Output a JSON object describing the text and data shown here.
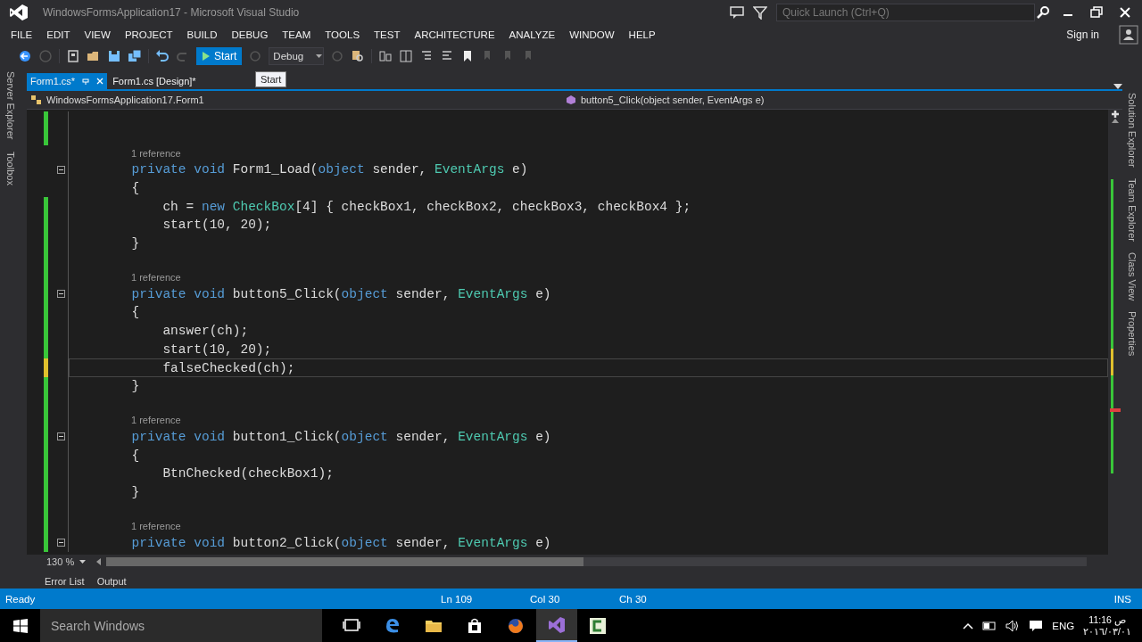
{
  "window": {
    "title": "WindowsFormsApplication17 - Microsoft Visual Studio",
    "quick_launch": {
      "placeholder": "Quick Launch (Ctrl+Q)"
    },
    "sign_in": "Sign in"
  },
  "menu": [
    "FILE",
    "EDIT",
    "VIEW",
    "PROJECT",
    "BUILD",
    "DEBUG",
    "TEAM",
    "TOOLS",
    "TEST",
    "ARCHITECTURE",
    "ANALYZE",
    "WINDOW",
    "HELP"
  ],
  "toolbar": {
    "start": {
      "label": "Start",
      "highlighted": true
    },
    "configuration": "Debug",
    "tooltip": "Start"
  },
  "left_panels": [
    "Server Explorer",
    "Toolbox"
  ],
  "tabs": [
    {
      "label": "Form1.cs*",
      "selected": true
    },
    {
      "label": "Form1.cs [Design]*",
      "selected": false
    }
  ],
  "nav": {
    "class": "WindowsFormsApplication17.Form1",
    "member": "button5_Click(object sender, EventArgs e)"
  },
  "editor": {
    "zoom": "130 %",
    "lines": [
      {
        "kind": "blank",
        "color": "#39c639"
      },
      {
        "kind": "blank",
        "color": "#39c639"
      },
      {
        "kind": "ref",
        "text": "1 reference"
      },
      {
        "kind": "code",
        "fold": true,
        "current": false,
        "tokens": [
          {
            "kind": "keyword",
            "text": "        private"
          },
          {
            "kind": "keyword",
            "text": " void"
          },
          {
            "kind": "plain",
            "text": " Form1_Load("
          },
          {
            "kind": "keyword",
            "text": "object"
          },
          {
            "kind": "plain",
            "text": " sender, "
          },
          {
            "kind": "type",
            "text": "EventArgs"
          },
          {
            "kind": "plain",
            "text": " e)"
          }
        ]
      },
      {
        "kind": "code",
        "fold": false,
        "current": false,
        "tokens": [
          {
            "kind": "plain",
            "text": "        {"
          }
        ]
      },
      {
        "kind": "code",
        "color": "#39c639",
        "fold": false,
        "current": false,
        "tokens": [
          {
            "kind": "plain",
            "text": "            ch = "
          },
          {
            "kind": "keyword",
            "text": "new"
          },
          {
            "kind": "type",
            "text": " CheckBox"
          },
          {
            "kind": "plain",
            "text": "[4] { checkBox1, checkBox2, checkBox3, checkBox4 };"
          }
        ]
      },
      {
        "kind": "code",
        "color": "#39c639",
        "fold": false,
        "current": false,
        "tokens": [
          {
            "kind": "plain",
            "text": "            start(10, 20);"
          }
        ]
      },
      {
        "kind": "code",
        "color": "#39c639",
        "fold": false,
        "current": false,
        "tokens": [
          {
            "kind": "plain",
            "text": "        }"
          }
        ]
      },
      {
        "kind": "blank",
        "color": "#39c639"
      },
      {
        "kind": "ref",
        "text": "1 reference",
        "color": "#39c639"
      },
      {
        "kind": "code",
        "color": "#39c639",
        "fold": true,
        "current": false,
        "tokens": [
          {
            "kind": "keyword",
            "text": "        private"
          },
          {
            "kind": "keyword",
            "text": " void"
          },
          {
            "kind": "plain",
            "text": " button5_Click("
          },
          {
            "kind": "keyword",
            "text": "object"
          },
          {
            "kind": "plain",
            "text": " sender, "
          },
          {
            "kind": "type",
            "text": "EventArgs"
          },
          {
            "kind": "plain",
            "text": " e)"
          }
        ]
      },
      {
        "kind": "code",
        "color": "#39c639",
        "fold": false,
        "current": false,
        "tokens": [
          {
            "kind": "plain",
            "text": "        {"
          }
        ]
      },
      {
        "kind": "code",
        "color": "#39c639",
        "fold": false,
        "current": false,
        "tokens": [
          {
            "kind": "plain",
            "text": "            answer(ch);"
          }
        ]
      },
      {
        "kind": "code",
        "color": "#39c639",
        "fold": false,
        "current": false,
        "tokens": [
          {
            "kind": "plain",
            "text": "            start(10, 20);"
          }
        ]
      },
      {
        "kind": "code",
        "color": "#e0c02d",
        "fold": false,
        "current": true,
        "tokens": [
          {
            "kind": "plain",
            "text": "            falseChecked(ch);"
          }
        ]
      },
      {
        "kind": "code",
        "color": "#39c639",
        "fold": false,
        "current": false,
        "tokens": [
          {
            "kind": "plain",
            "text": "        }"
          }
        ]
      },
      {
        "kind": "blank",
        "color": "#39c639"
      },
      {
        "kind": "ref",
        "text": "1 reference",
        "color": "#39c639"
      },
      {
        "kind": "code",
        "color": "#39c639",
        "fold": true,
        "current": false,
        "tokens": [
          {
            "kind": "keyword",
            "text": "        private"
          },
          {
            "kind": "keyword",
            "text": " void"
          },
          {
            "kind": "plain",
            "text": " button1_Click("
          },
          {
            "kind": "keyword",
            "text": "object"
          },
          {
            "kind": "plain",
            "text": " sender, "
          },
          {
            "kind": "type",
            "text": "EventArgs"
          },
          {
            "kind": "plain",
            "text": " e)"
          }
        ]
      },
      {
        "kind": "code",
        "color": "#39c639",
        "fold": false,
        "current": false,
        "tokens": [
          {
            "kind": "plain",
            "text": "        {"
          }
        ]
      },
      {
        "kind": "code",
        "color": "#39c639",
        "fold": false,
        "current": false,
        "tokens": [
          {
            "kind": "plain",
            "text": "            BtnChecked(checkBox1);"
          }
        ]
      },
      {
        "kind": "code",
        "color": "#39c639",
        "fold": false,
        "current": false,
        "tokens": [
          {
            "kind": "plain",
            "text": "        }"
          }
        ]
      },
      {
        "kind": "blank",
        "color": "#39c639"
      },
      {
        "kind": "ref",
        "text": "1 reference",
        "color": "#39c639"
      },
      {
        "kind": "code",
        "color": "#39c639",
        "fold": true,
        "current": false,
        "tokens": [
          {
            "kind": "keyword",
            "text": "        private"
          },
          {
            "kind": "keyword",
            "text": " void"
          },
          {
            "kind": "plain",
            "text": " button2_Click("
          },
          {
            "kind": "keyword",
            "text": "object"
          },
          {
            "kind": "plain",
            "text": " sender, "
          },
          {
            "kind": "type",
            "text": "EventArgs"
          },
          {
            "kind": "plain",
            "text": " e)"
          }
        ]
      }
    ]
  },
  "right_panels": [
    "Solution Explorer",
    "Team Explorer",
    "Class View",
    "Properties"
  ],
  "bottom_tabs": [
    "Error List",
    "Output"
  ],
  "status_bar": {
    "message": "Ready",
    "line": "Ln 109",
    "col": "Col 30",
    "ch": "Ch 30",
    "mode": "INS"
  },
  "taskbar": {
    "search": {
      "placeholder": "Search Windows"
    },
    "apps": [
      {
        "kind": "task-view",
        "active": false
      },
      {
        "kind": "edge",
        "active": false
      },
      {
        "kind": "folder",
        "active": false
      },
      {
        "kind": "store",
        "active": false
      },
      {
        "kind": "firefox",
        "active": false
      },
      {
        "kind": "visual-studio",
        "active": true
      },
      {
        "kind": "camtasia",
        "active": false
      }
    ],
    "language": "ENG",
    "time": "11:16 ص",
    "date": "٢٠١٦/٠٣/٠١"
  }
}
